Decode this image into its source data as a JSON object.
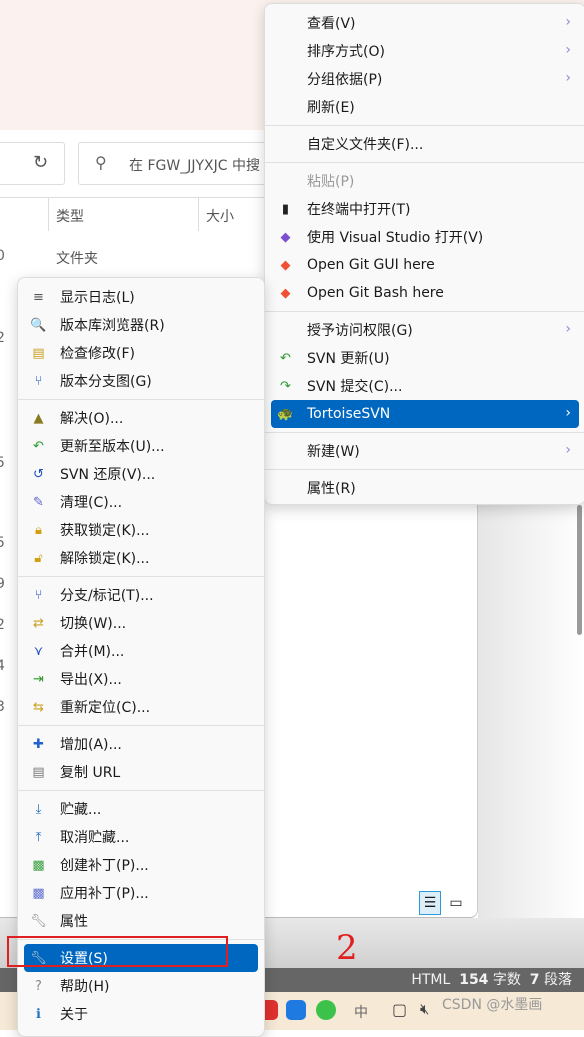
{
  "explorer": {
    "search_placeholder": "在 FGW_JJYXJC 中搜",
    "columns": [
      "类型",
      "大小"
    ],
    "first_row_type": "文件夹",
    "row_numbers": [
      "0",
      "2",
      "5",
      "5",
      "9",
      "2",
      "4",
      "3"
    ]
  },
  "annotation": {
    "step": "2"
  },
  "status_bar": {
    "mode": "HTML",
    "words_count": "154",
    "words_label": "字数",
    "para_count": "7",
    "para_label": "段落"
  },
  "taskbar": {
    "ime": "中",
    "watermark": "CSDN @水墨画"
  },
  "context_menu": {
    "groups": [
      [
        {
          "label": "查看(V)",
          "submenu": true
        },
        {
          "label": "排序方式(O)",
          "submenu": true
        },
        {
          "label": "分组依据(P)",
          "submenu": true
        },
        {
          "label": "刷新(E)"
        }
      ],
      [
        {
          "label": "自定义文件夹(F)..."
        }
      ],
      [
        {
          "label": "粘贴(P)",
          "disabled": true
        },
        {
          "label": "在终端中打开(T)",
          "icon": "terminal-icon"
        },
        {
          "label": "使用 Visual Studio 打开(V)",
          "icon": "visual-studio-icon"
        },
        {
          "label": "Open Git GUI here",
          "icon": "git-icon"
        },
        {
          "label": "Open Git Bash here",
          "icon": "git-icon"
        }
      ],
      [
        {
          "label": "授予访问权限(G)",
          "submenu": true
        },
        {
          "label": "SVN 更新(U)",
          "icon": "svn-update-icon"
        },
        {
          "label": "SVN 提交(C)...",
          "icon": "svn-commit-icon"
        },
        {
          "label": "TortoiseSVN",
          "icon": "tortoisesvn-icon",
          "submenu": true,
          "highlighted": true
        }
      ],
      [
        {
          "label": "新建(W)",
          "submenu": true
        }
      ],
      [
        {
          "label": "属性(R)"
        }
      ]
    ]
  },
  "svn_menu": {
    "groups": [
      [
        {
          "label": "显示日志(L)",
          "icon": "log-icon"
        },
        {
          "label": "版本库浏览器(R)",
          "icon": "repo-browser-icon"
        },
        {
          "label": "检查修改(F)",
          "icon": "check-modifications-icon"
        },
        {
          "label": "版本分支图(G)",
          "icon": "revision-graph-icon"
        }
      ],
      [
        {
          "label": "解决(O)...",
          "icon": "resolve-icon"
        },
        {
          "label": "更新至版本(U)...",
          "icon": "update-to-revision-icon"
        },
        {
          "label": "SVN 还原(V)...",
          "icon": "revert-icon"
        },
        {
          "label": "清理(C)...",
          "icon": "cleanup-icon"
        },
        {
          "label": "获取锁定(K)...",
          "icon": "lock-icon"
        },
        {
          "label": "解除锁定(K)...",
          "icon": "unlock-icon"
        }
      ],
      [
        {
          "label": "分支/标记(T)...",
          "icon": "branch-icon"
        },
        {
          "label": "切换(W)...",
          "icon": "switch-icon"
        },
        {
          "label": "合并(M)...",
          "icon": "merge-icon"
        },
        {
          "label": "导出(X)...",
          "icon": "export-icon"
        },
        {
          "label": "重新定位(C)...",
          "icon": "relocate-icon"
        }
      ],
      [
        {
          "label": "增加(A)...",
          "icon": "add-icon"
        },
        {
          "label": "复制 URL",
          "icon": "copy-url-icon"
        }
      ],
      [
        {
          "label": "贮藏...",
          "icon": "shelve-icon"
        },
        {
          "label": "取消贮藏...",
          "icon": "unshelve-icon"
        },
        {
          "label": "创建补丁(P)...",
          "icon": "create-patch-icon"
        },
        {
          "label": "应用补丁(P)...",
          "icon": "apply-patch-icon"
        },
        {
          "label": "属性",
          "icon": "properties-icon"
        }
      ],
      [
        {
          "label": "设置(S)",
          "icon": "settings-icon",
          "highlighted": true
        },
        {
          "label": "帮助(H)",
          "icon": "help-icon"
        },
        {
          "label": "关于",
          "icon": "about-icon"
        }
      ]
    ]
  }
}
